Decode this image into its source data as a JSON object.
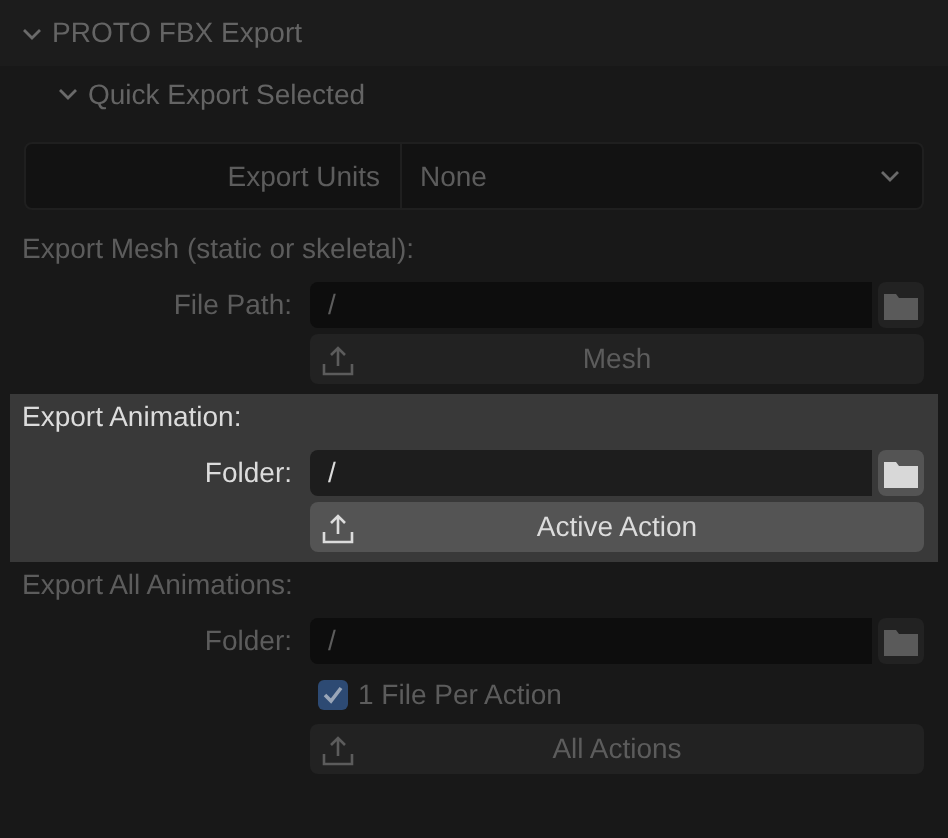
{
  "panel": {
    "title": "PROTO FBX Export",
    "expanded": true
  },
  "subpanel": {
    "title": "Quick Export Selected",
    "expanded": true
  },
  "export_units": {
    "label": "Export Units",
    "value": "None"
  },
  "sections": [
    {
      "title": "Export Mesh (static or skeletal):",
      "highlighted": false,
      "rows": [
        {
          "kind": "path",
          "label": "File Path:",
          "value": "/"
        },
        {
          "kind": "button",
          "label": "Mesh"
        }
      ]
    },
    {
      "title": "Export Animation:",
      "highlighted": true,
      "rows": [
        {
          "kind": "path",
          "label": "Folder:",
          "value": "/"
        },
        {
          "kind": "button",
          "label": "Active Action"
        }
      ]
    },
    {
      "title": "Export All Animations:",
      "highlighted": false,
      "rows": [
        {
          "kind": "path",
          "label": "Folder:",
          "value": "/"
        },
        {
          "kind": "checkbox",
          "label": "1 File Per Action",
          "checked": true
        },
        {
          "kind": "button",
          "label": "All Actions"
        }
      ]
    }
  ]
}
